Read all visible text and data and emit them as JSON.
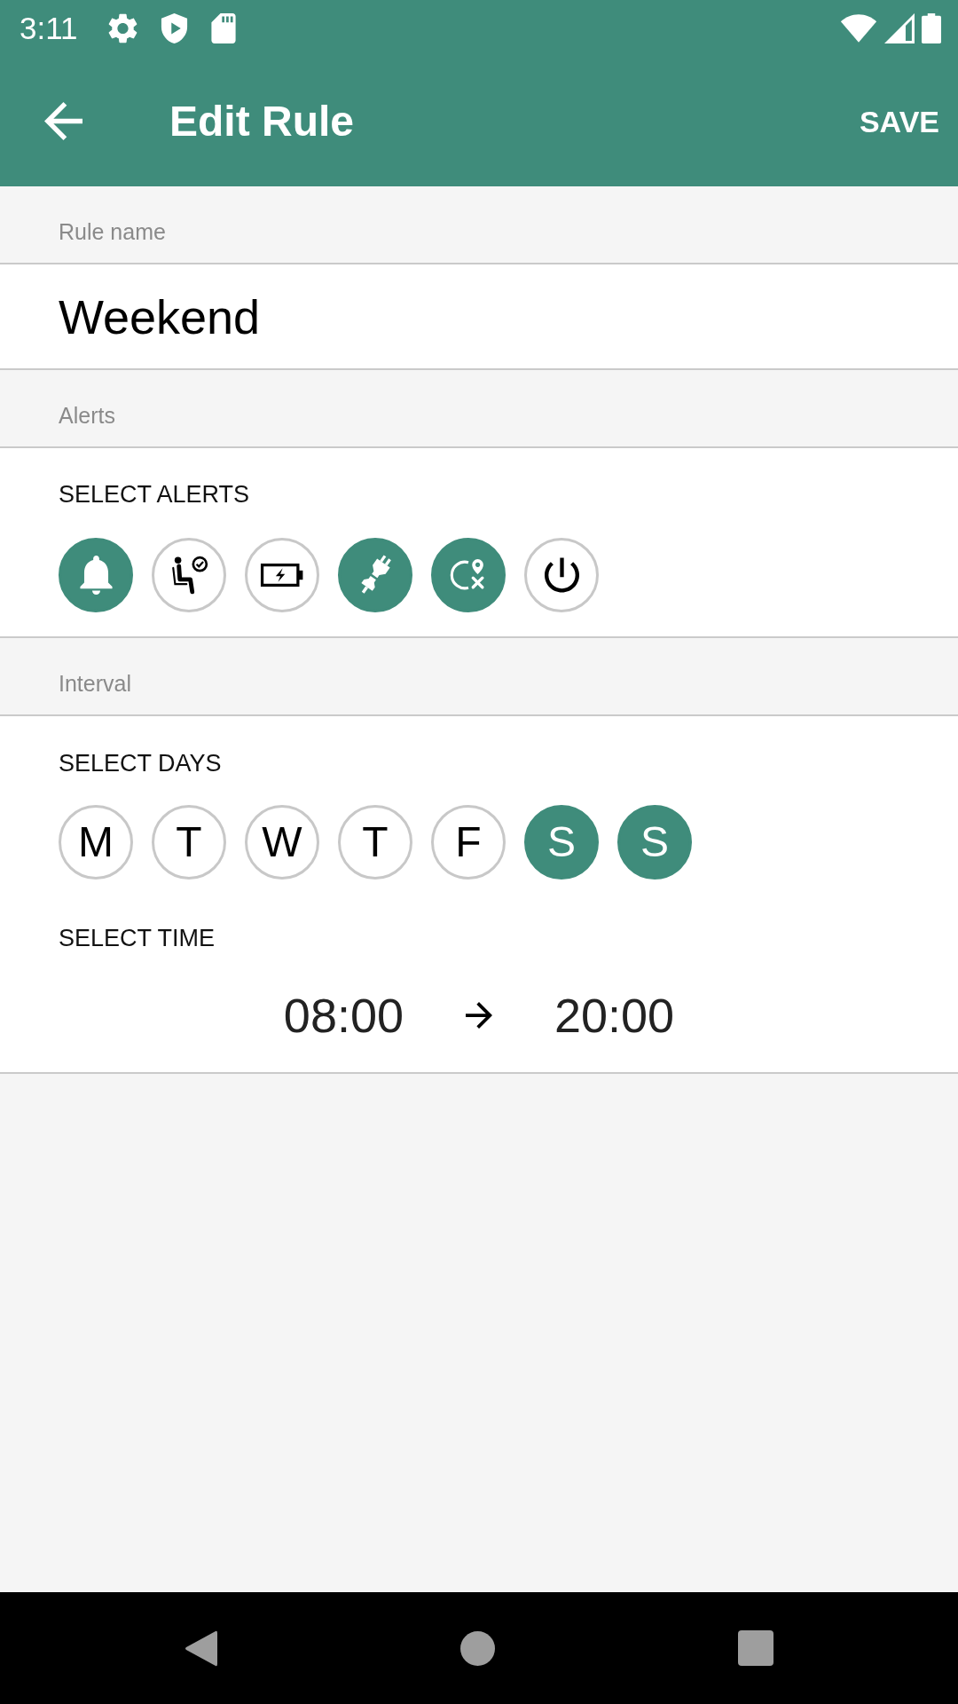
{
  "status_bar": {
    "time": "3:11"
  },
  "app_bar": {
    "title": "Edit Rule",
    "action": "SAVE"
  },
  "rule_name": {
    "header": "Rule name",
    "value": "Weekend"
  },
  "alerts": {
    "header": "Alerts",
    "label": "SELECT ALERTS",
    "items": [
      {
        "kind": "bell",
        "selected": true
      },
      {
        "kind": "waiting",
        "selected": false
      },
      {
        "kind": "battery",
        "selected": false
      },
      {
        "kind": "plug",
        "selected": true
      },
      {
        "kind": "location",
        "selected": true
      },
      {
        "kind": "power",
        "selected": false
      }
    ]
  },
  "interval": {
    "header": "Interval",
    "days_label": "SELECT DAYS",
    "days": [
      {
        "label": "M",
        "selected": false
      },
      {
        "label": "T",
        "selected": false
      },
      {
        "label": "W",
        "selected": false
      },
      {
        "label": "T",
        "selected": false
      },
      {
        "label": "F",
        "selected": false
      },
      {
        "label": "S",
        "selected": true
      },
      {
        "label": "S",
        "selected": true
      }
    ],
    "time_label": "SELECT TIME",
    "start": "08:00",
    "end": "20:00"
  }
}
